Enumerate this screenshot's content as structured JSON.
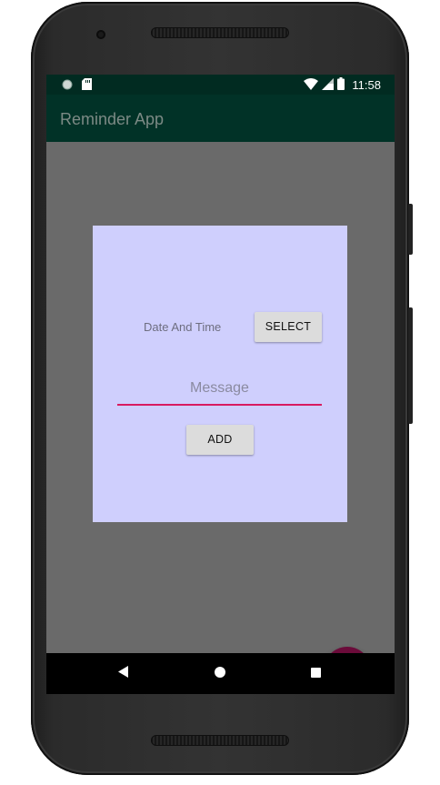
{
  "status_bar": {
    "time": "11:58",
    "icons_left": [
      "circle-notification-icon",
      "sd-card-icon"
    ],
    "icons_right": [
      "wifi-icon",
      "signal-icon",
      "battery-icon"
    ]
  },
  "app_bar": {
    "title": "Reminder App"
  },
  "dialog": {
    "date_time_label": "Date And Time",
    "select_label": "SELECT",
    "message_placeholder": "Message",
    "message_value": "",
    "add_label": "ADD"
  },
  "fab": {
    "icon": "add-icon"
  },
  "nav_bar": {
    "buttons": [
      "back-icon",
      "home-icon",
      "recents-icon"
    ]
  },
  "colors": {
    "status_bar": "#012b21",
    "app_bar": "#013227",
    "background": "#6a6a6a",
    "card": "#cfcffd",
    "accent": "#d81b60",
    "fab": "#6b0b3a"
  }
}
